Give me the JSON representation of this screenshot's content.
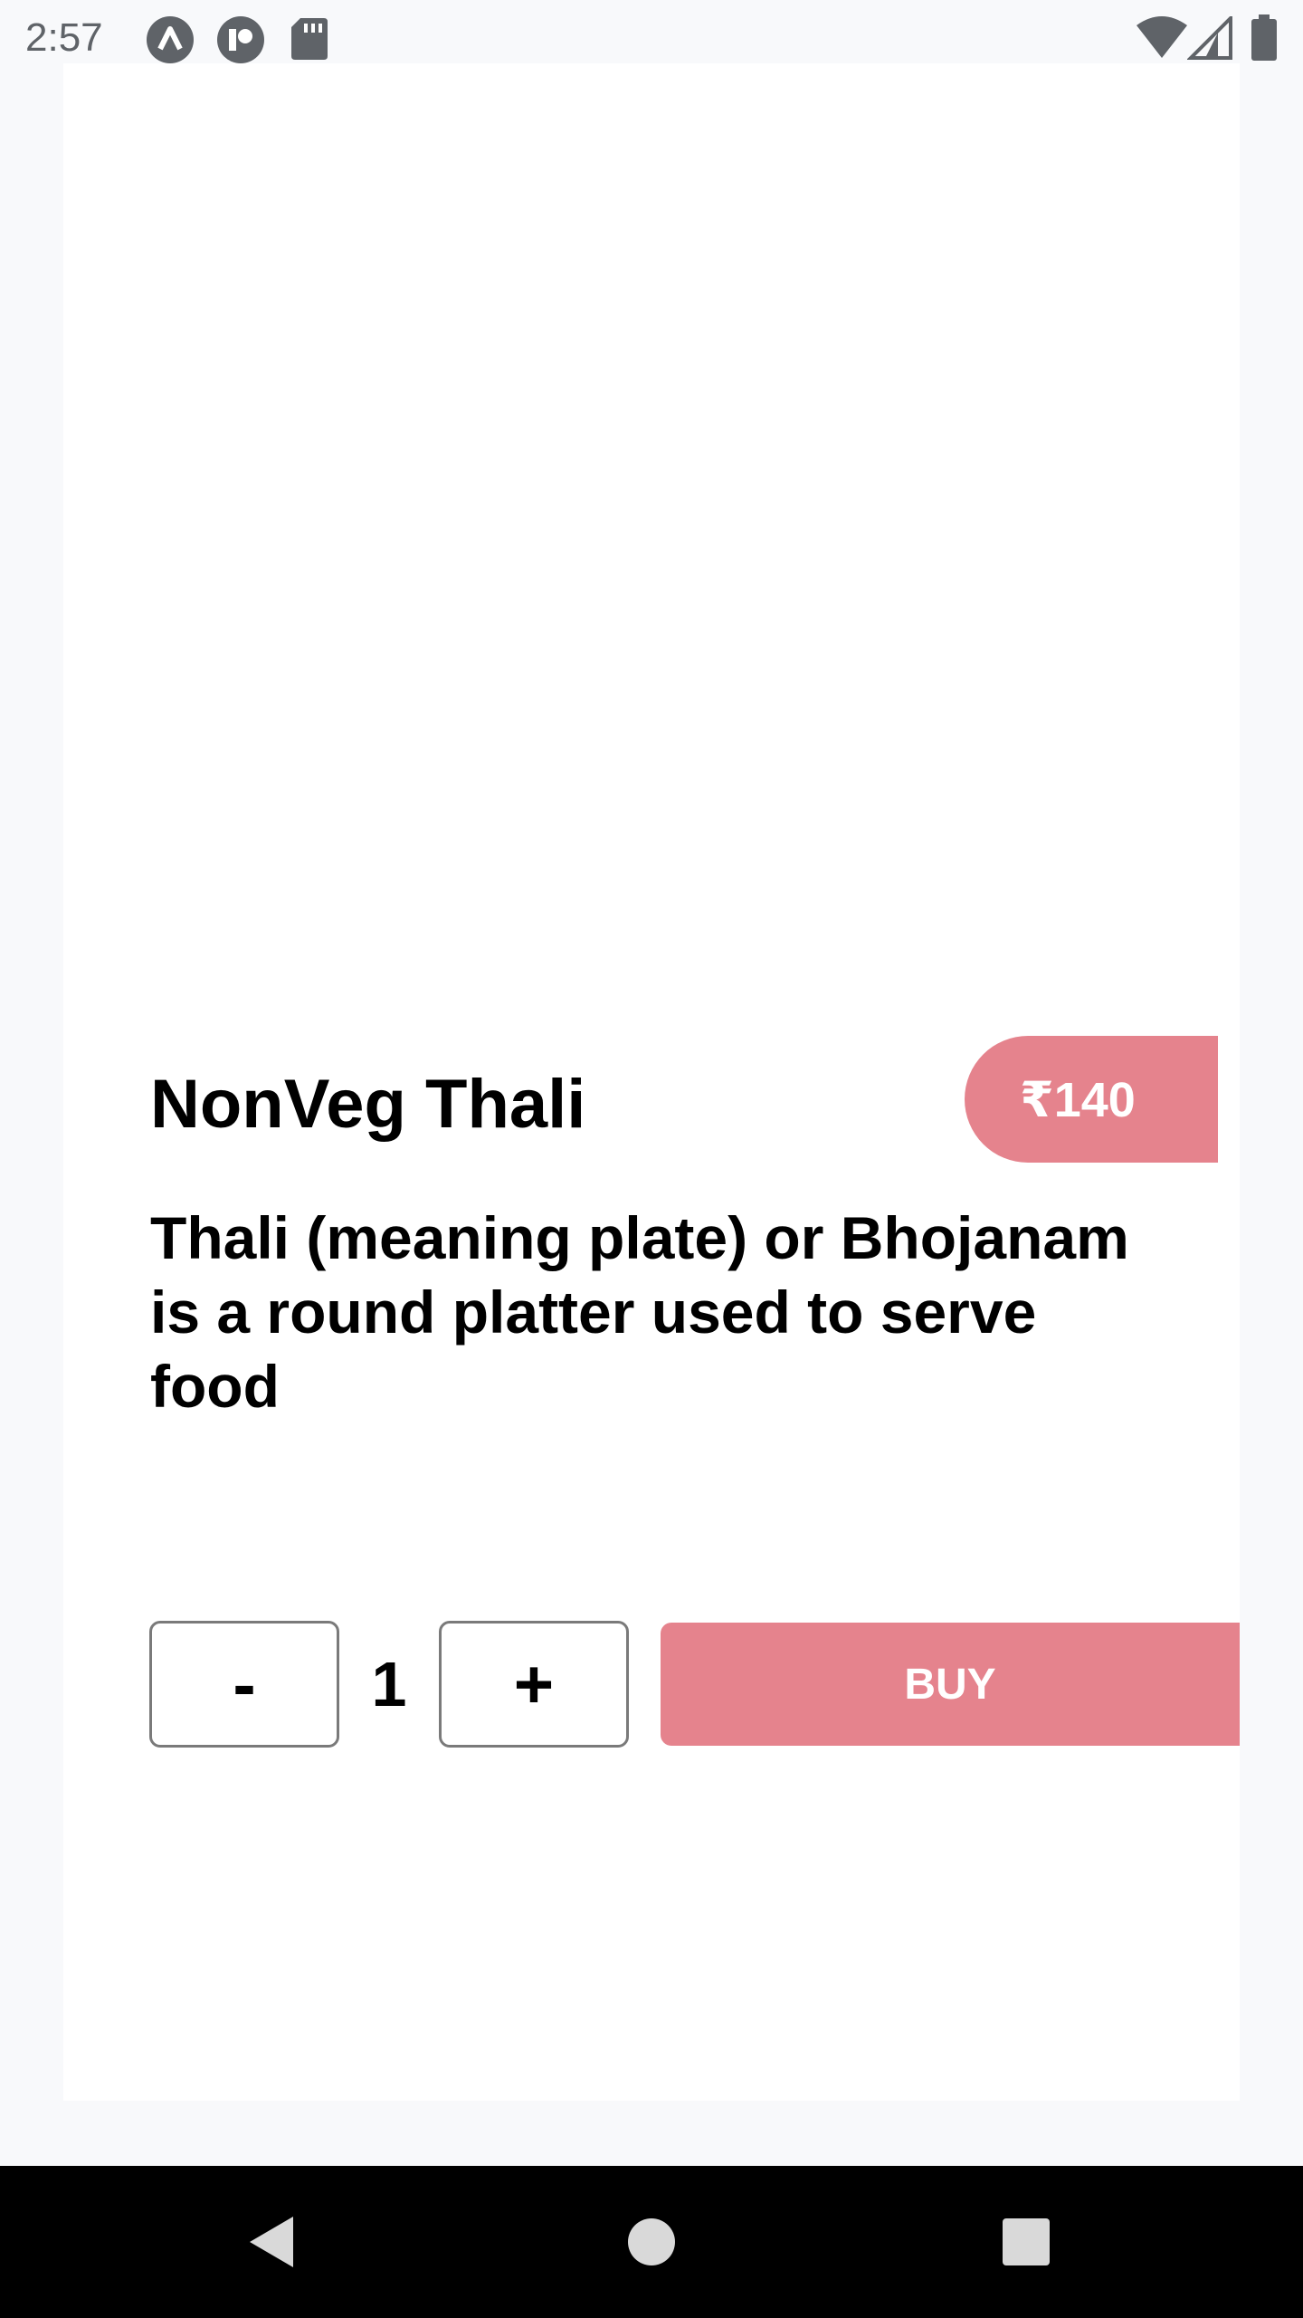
{
  "status_bar": {
    "time": "2:57",
    "icons": [
      "arrow-notification-icon",
      "app-notification-icon",
      "sd-card-icon",
      "wifi-icon",
      "cell-signal-icon",
      "battery-icon"
    ]
  },
  "product": {
    "title": "NonVeg Thali",
    "price": "₹140",
    "description": "Thali (meaning plate) or Bhojanam is a round platter used to serve food"
  },
  "quantity": {
    "decrement_label": "-",
    "value": "1",
    "increment_label": "+"
  },
  "buy_button": {
    "label": "BUY"
  },
  "colors": {
    "accent": "#e5838d",
    "card_background": "#ffffff",
    "page_background": "#f8f9fb",
    "nav_bar": "#000000"
  },
  "nav_bar": {
    "buttons": [
      "back-icon",
      "home-icon",
      "recents-icon"
    ]
  }
}
